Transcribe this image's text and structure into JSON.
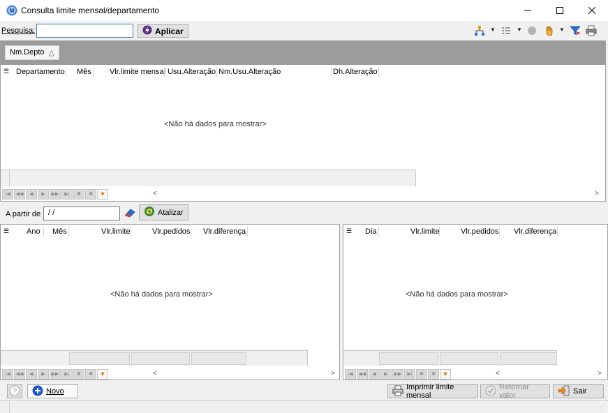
{
  "window": {
    "title": "Consulta limite mensal/departamento",
    "minimize_glyph": "—",
    "maximize_glyph": "☐",
    "close_glyph": "✕"
  },
  "search": {
    "label": "Pesquisa:",
    "value": "",
    "apply_label": "Aplicar"
  },
  "toolbar_icons": [
    "hierarchy-icon",
    "list-view-icon",
    "circle-icon",
    "hand-icon",
    "filter-icon",
    "printer-icon"
  ],
  "top_grid": {
    "group_chip": "Nm.Depto",
    "sort_glyph": "△",
    "columns": [
      "Departamento",
      "Mês",
      "Vlr.limite mensal",
      "Usu.Alteração",
      "Nm.Usu.Alteração",
      "Dh.Alteração"
    ],
    "empty_message": "<Não há dados para mostrar>"
  },
  "filter_row": {
    "from_label": "A partir de",
    "date_value": "/ /",
    "update_label": "Atalizar"
  },
  "month_grid": {
    "columns": [
      "Ano",
      "Mês",
      "Vlr.limite",
      "Vlr.pedidos",
      "Vlr.diferença"
    ],
    "empty_message": "<Não há dados para mostrar>"
  },
  "day_grid": {
    "columns": [
      "Dia",
      "Vlr.limite",
      "Vlr.pedidos",
      "Vlr.diferença"
    ],
    "empty_message": "<Não há dados para mostrar>"
  },
  "bottom": {
    "new_label": "Novo",
    "print_label": "Imprimir limite mensal",
    "return_label": "Retornar valor",
    "exit_label": "Sair"
  },
  "colors": {
    "group_band": "#9c9c9c",
    "accent_blue": "#1e56c8",
    "filter_orange": "#e07b00"
  }
}
